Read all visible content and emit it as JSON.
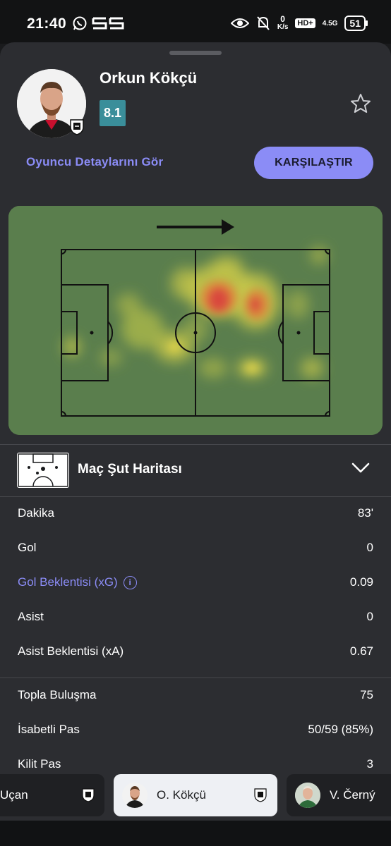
{
  "status_bar": {
    "time": "21:40",
    "net_speed_value": "0",
    "net_speed_unit": "K/s",
    "hd_label": "HD+",
    "signal_label": "4.5G",
    "battery": "51"
  },
  "player": {
    "name": "Orkun Kökçü",
    "rating": "8.1",
    "rating_color": "#3a8e9a"
  },
  "actions": {
    "details_link": "Oyuncu Detaylarını Gör",
    "compare_button": "KARŞILAŞTIR"
  },
  "heatmap": {
    "direction": "attack-right",
    "pitch_color": "#5a7e4d"
  },
  "shot_map": {
    "title": "Maç Şut Haritası",
    "expand_icon": "chevron-down-icon"
  },
  "stats_group_1": [
    {
      "label": "Dakika",
      "value": "83'"
    },
    {
      "label": "Gol",
      "value": "0"
    },
    {
      "label": "Gol Beklentisi (xG)",
      "value": "0.09"
    },
    {
      "label": "Asist",
      "value": "0"
    },
    {
      "label": "Asist Beklentisi (xA)",
      "value": "0.67"
    }
  ],
  "stats_group_2": [
    {
      "label": "Topla Buluşma",
      "value": "75"
    },
    {
      "label": "İsabetli Pas",
      "value": "50/59 (85%)"
    },
    {
      "label": "Kilit Pas",
      "value": "3"
    }
  ],
  "player_tabs": [
    {
      "name": "Uçan"
    },
    {
      "name": "O. Kökçü"
    },
    {
      "name": "V. Černý"
    }
  ],
  "colors": {
    "accent": "#8b8cf6",
    "sheet": "#2c2d31",
    "background": "#1a1b1d"
  }
}
